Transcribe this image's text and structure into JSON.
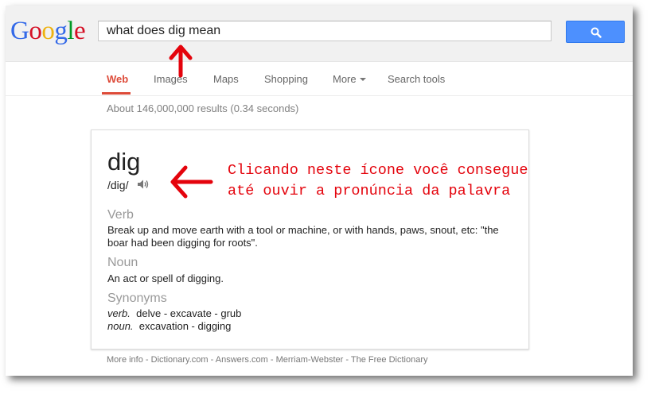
{
  "logo": {
    "letters": [
      {
        "ch": "G",
        "color": "#3369e8"
      },
      {
        "ch": "o",
        "color": "#d50f25"
      },
      {
        "ch": "o",
        "color": "#eeb211"
      },
      {
        "ch": "g",
        "color": "#3369e8"
      },
      {
        "ch": "l",
        "color": "#009925"
      },
      {
        "ch": "e",
        "color": "#d50f25"
      }
    ]
  },
  "search": {
    "query": "what does dig mean",
    "button_icon": "search-icon"
  },
  "nav": {
    "tabs": [
      {
        "label": "Web",
        "active": true
      },
      {
        "label": "Images"
      },
      {
        "label": "Maps"
      },
      {
        "label": "Shopping"
      },
      {
        "label": "More"
      },
      {
        "label": "Search tools"
      }
    ]
  },
  "results": {
    "stats": "About 146,000,000 results (0.34 seconds)"
  },
  "definition": {
    "word": "dig",
    "phonetic": "/dig/",
    "speaker_icon": "speaker-icon",
    "verb_label": "Verb",
    "verb_def_line1": "Break up and move earth with a tool or machine, or with hands, paws, snout, etc: \"the",
    "verb_def_line2": "boar had been digging for roots\".",
    "noun_label": "Noun",
    "noun_def": "An act or spell of digging.",
    "synonyms_label": "Synonyms",
    "synonyms": [
      {
        "pos": "verb.",
        "words": "delve - excavate - grub"
      },
      {
        "pos": "noun.",
        "words": "excavation - digging"
      }
    ]
  },
  "more_info": {
    "prefix": "More info",
    "sep": " - ",
    "links": [
      "Dictionary.com",
      "Answers.com",
      "Merriam-Webster",
      "The Free Dictionary"
    ]
  },
  "annotation": {
    "line1": "Clicando neste ícone você consegue",
    "line2": "até ouvir a pronúncia da palavra",
    "color": "#e4030c"
  },
  "colors": {
    "accent_red": "#dd4b39",
    "search_blue": "#4d90fe"
  }
}
